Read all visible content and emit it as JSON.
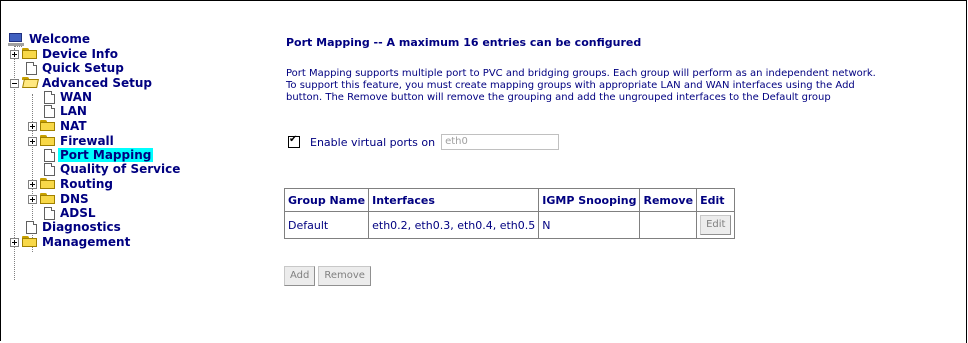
{
  "tree": {
    "welcome": "Welcome",
    "device_info": "Device Info",
    "quick_setup": "Quick Setup",
    "advanced_setup": "Advanced Setup",
    "wan": "WAN",
    "lan": "LAN",
    "nat": "NAT",
    "firewall": "Firewall",
    "port_mapping": "Port Mapping",
    "qos": "Quality of Service",
    "routing": "Routing",
    "dns": "DNS",
    "adsl": "ADSL",
    "diagnostics": "Diagnostics",
    "management": "Management"
  },
  "main": {
    "title": "Port Mapping -- A maximum 16 entries can be configured",
    "desc_line1": "Port Mapping supports multiple port to PVC and bridging groups. Each group will perform as an independent network.",
    "desc_line2": "To support this feature, you must create mapping groups with appropriate LAN and WAN interfaces using the Add",
    "desc_line3": "button. The Remove button will remove the grouping and add the ungrouped interfaces to the Default group",
    "enable_label": "Enable virtual ports on",
    "enable_checked": true,
    "enable_input_value": "eth0"
  },
  "table": {
    "headers": [
      "Group Name",
      "Interfaces",
      "IGMP Snooping",
      "Remove",
      "Edit"
    ],
    "rows": [
      {
        "group": "Default",
        "interfaces": "eth0.2, eth0.3, eth0.4, eth0.5",
        "igmp": "N",
        "remove": "",
        "edit": "Edit"
      }
    ]
  },
  "buttons": {
    "add": "Add",
    "remove": "Remove"
  },
  "colors": {
    "text": "#000080",
    "selected_bg": "#00ffff"
  }
}
